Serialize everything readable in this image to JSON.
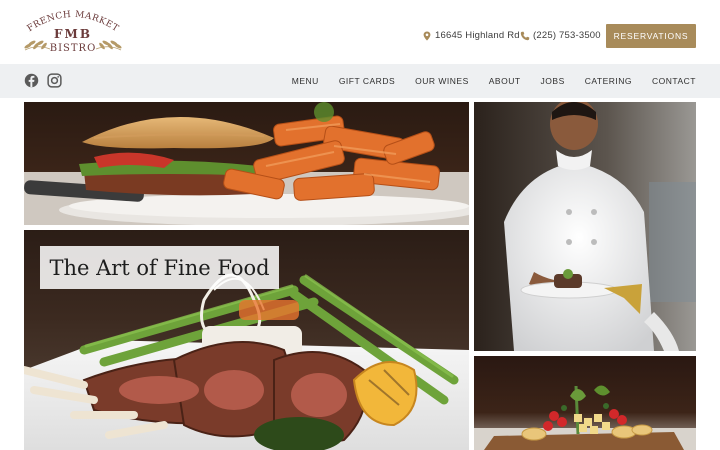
{
  "brand": {
    "arc_text": "FRENCH MARKET",
    "initials": "FMB",
    "word": "BISTRO",
    "color": "#6b3b3b"
  },
  "header": {
    "address": "16645 Highland Rd",
    "phone": "(225) 753-3500",
    "reservations_label": "RESERVATIONS",
    "accent_color": "#a88b5a"
  },
  "social": {
    "icons": [
      "facebook-icon",
      "instagram-icon"
    ]
  },
  "nav": {
    "items": [
      {
        "label": "MENU"
      },
      {
        "label": "GIFT CARDS"
      },
      {
        "label": "OUR WINES"
      },
      {
        "label": "ABOUT"
      },
      {
        "label": "JOBS"
      },
      {
        "label": "CATERING"
      },
      {
        "label": "CONTACT"
      }
    ]
  },
  "hero": {
    "title": "The Art of Fine Food"
  }
}
